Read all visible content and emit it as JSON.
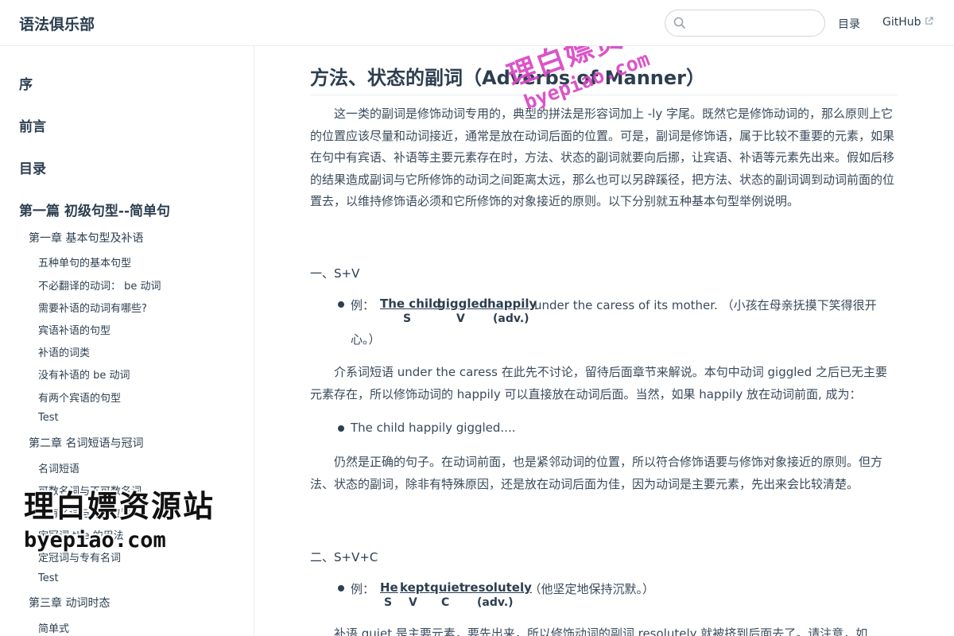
{
  "navbar": {
    "site_name": "语法俱乐部",
    "search_placeholder": "",
    "links": {
      "toc": "目录",
      "github": "GitHub"
    }
  },
  "sidebar": {
    "top_items": [
      "序",
      "前言",
      "目录",
      "第一篇 初级句型--简单句"
    ],
    "chapters": [
      "第一章 基本句型及补语",
      "第二章 名词短语与冠词",
      "第三章 动词时态"
    ],
    "chapter1_items": [
      "五种单句的基本句型",
      "不必翻译的动词： be 动词",
      "需要补语的动词有哪些?",
      "宾语补语的句型",
      "补语的词类",
      "没有补语的 be 动词",
      "有两个宾语的句型",
      "Test"
    ],
    "chapter2_items": [
      "名词短语",
      "可数名词与不可数名词",
      "专有名词与补语位置",
      "定冠词 the 的用法",
      "定冠词与专有名词",
      "Test"
    ],
    "chapter3_items": [
      "简单式"
    ]
  },
  "watermark": {
    "cn": "理白嫖资源站",
    "url": "byepiao.com"
  },
  "content": {
    "title": "方法、状态的副词（Adverbs of Manner）",
    "intro": "这一类的副词是修饰动词专用的，典型的拼法是形容词加上 -ly 字尾。既然它是修饰动词的，那么原则上它的位置应该尽量和动词接近，通常是放在动词后面的位置。可是，副词是修饰语，属于比较不重要的元素，如果在句中有宾语、补语等主要元素存在时，方法、状态的副词就要向后挪，让宾语、补语等元素先出来。假如后移的结果造成副词与它所修饰的动词之间距离太远，那么也可以另辟蹊径，把方法、状态的副词调到动词前面的位置去，以维持修饰语必须和它所修饰的对象接近的原则。以下分别就五种基本句型举例说明。",
    "section1": {
      "heading": "一、S+V",
      "ex_label": "例：",
      "words": [
        "The child",
        "giggled",
        "happily"
      ],
      "tags": [
        "S",
        "V",
        "(adv.)"
      ],
      "rest": "under the caress of its mother. （小孩在母亲抚摸下笑得很开",
      "rest2": "心。）",
      "para1": "介系词短语 under the caress 在此先不讨论，留待后面章节来解说。本句中动词 giggled 之后已无主要元素存在，所以修饰动词的 happily 可以直接放在动词后面。当然，如果 happily 放在动词前面, 成为：",
      "bullet2": "The child happily giggled....",
      "para2": "仍然是正确的句子。在动词前面，也是紧邻动词的位置，所以符合修饰语要与修饰对象接近的原则。但方法、状态的副词，除非有特殊原因，还是放在动词后面为佳，因为动词是主要元素，先出来会比较清楚。"
    },
    "section2": {
      "heading": "二、S+V+C",
      "ex_label": "例：",
      "words": [
        "He",
        "kept",
        "quiet",
        "resolutely"
      ],
      "tags": [
        "S",
        "V",
        "C",
        "(adv.)"
      ],
      "rest": ". （他坚定地保持沉默。）",
      "para1": "补语 quiet 是主要元素，要先出来，所以修饰动词的副词 resolutely 就被挤到后面去了。请注意，如"
    }
  }
}
